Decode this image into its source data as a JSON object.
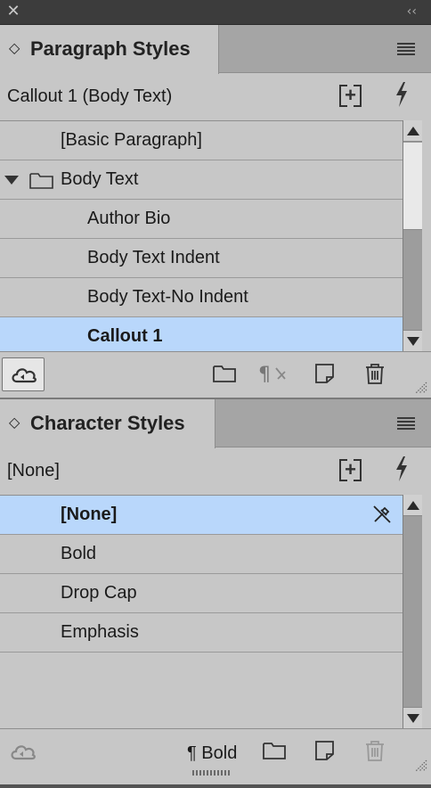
{
  "titlebar": {
    "close_glyph": "✕",
    "collapse_glyph": "‹‹"
  },
  "paragraph_panel": {
    "tab_title": "Paragraph Styles",
    "updown_glyph": "◇",
    "current_style": "Callout 1 (Body Text)",
    "styles": [
      {
        "label": "[Basic Paragraph]",
        "indent": 1,
        "selected": false
      },
      {
        "label": "Body Text",
        "indent": 0,
        "group": true,
        "expanded": true,
        "selected": false
      },
      {
        "label": "Author Bio",
        "indent": 2,
        "selected": false
      },
      {
        "label": "Body Text Indent",
        "indent": 2,
        "selected": false
      },
      {
        "label": "Body Text-No Indent",
        "indent": 2,
        "selected": false
      },
      {
        "label": "Callout 1",
        "indent": 2,
        "selected": true
      }
    ],
    "bottom_icons": [
      "cloud-sync-icon",
      "new-group-folder-icon",
      "clear-overrides-icon",
      "new-style-icon",
      "trash-icon"
    ]
  },
  "character_panel": {
    "tab_title": "Character Styles",
    "updown_glyph": "◇",
    "current_style": "[None]",
    "styles": [
      {
        "label": "[None]",
        "selected": true,
        "locked": true
      },
      {
        "label": "Bold",
        "selected": false
      },
      {
        "label": "Drop Cap",
        "selected": false
      },
      {
        "label": "Emphasis",
        "selected": false
      }
    ],
    "bottom_label": "¶ Bold",
    "bottom_icons": [
      "cloud-sync-icon",
      "new-group-folder-icon",
      "new-style-icon",
      "trash-icon"
    ]
  },
  "colors": {
    "panel_bg": "#c7c7c7",
    "selection": "#b9d7fb",
    "tab_strip": "#a5a5a5"
  }
}
